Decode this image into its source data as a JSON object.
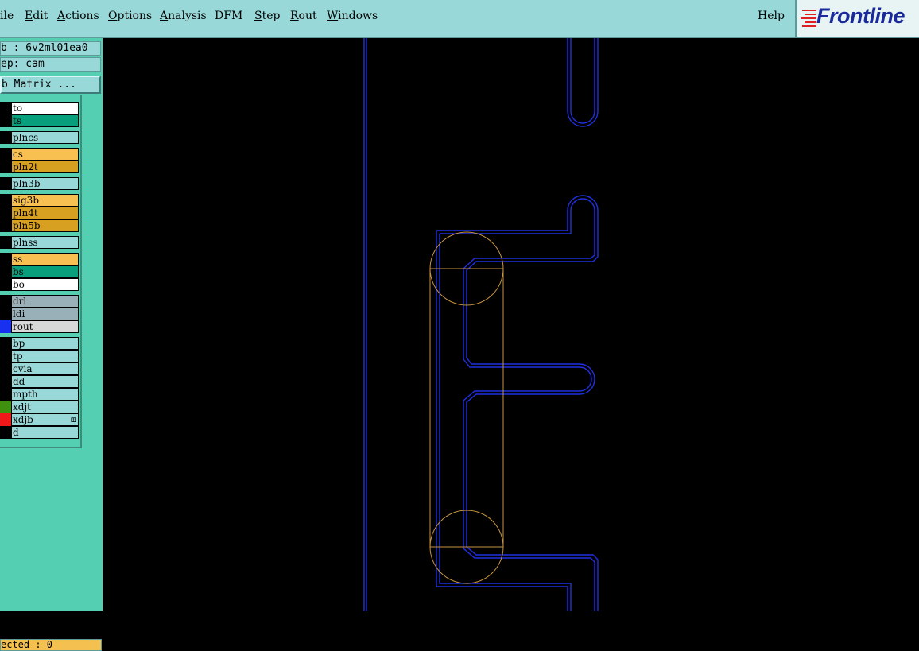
{
  "menu": {
    "items": [
      {
        "pre": "",
        "u": "",
        "post": "ile"
      },
      {
        "pre": "",
        "u": "E",
        "post": "dit"
      },
      {
        "pre": "",
        "u": "A",
        "post": "ctions"
      },
      {
        "pre": "",
        "u": "O",
        "post": "ptions"
      },
      {
        "pre": "",
        "u": "A",
        "post": "nalysis"
      },
      {
        "pre": "",
        "u": "",
        "post": "DFM"
      },
      {
        "pre": "",
        "u": "S",
        "post": "tep"
      },
      {
        "pre": "",
        "u": "R",
        "post": "out"
      },
      {
        "pre": "",
        "u": "W",
        "post": "indows"
      }
    ],
    "help": "Help"
  },
  "logo": {
    "text": "Frontline",
    "color": "#1a2a9a",
    "accent": "#e02020"
  },
  "sidebar": {
    "job": "b : 6v2ml01ea0",
    "step": "ep: cam",
    "matrix_button": "b Matrix ...",
    "selected": "ected : 0"
  },
  "layers": [
    {
      "name": "to",
      "bg": "#ffffff",
      "swatch": "#000000"
    },
    {
      "name": "ts",
      "bg": "#08a07c",
      "swatch": "#000000"
    },
    {
      "name": "plncs",
      "bg": "#99d8d8",
      "swatch": "#000000"
    },
    {
      "name": "cs",
      "bg": "#f8c050",
      "swatch": "#000000"
    },
    {
      "name": "pln2t",
      "bg": "#d8a020",
      "swatch": "#000000"
    },
    {
      "name": "pln3b",
      "bg": "#99d8d8",
      "swatch": "#000000"
    },
    {
      "name": "sig3b",
      "bg": "#f8c050",
      "swatch": "#000000"
    },
    {
      "name": "pln4t",
      "bg": "#d8a020",
      "swatch": "#000000"
    },
    {
      "name": "pln5b",
      "bg": "#d8a020",
      "swatch": "#000000"
    },
    {
      "name": "plnss",
      "bg": "#99d8d8",
      "swatch": "#000000"
    },
    {
      "name": "ss",
      "bg": "#f8c050",
      "swatch": "#000000"
    },
    {
      "name": "bs",
      "bg": "#08a07c",
      "swatch": "#000000"
    },
    {
      "name": "bo",
      "bg": "#ffffff",
      "swatch": "#000000"
    },
    {
      "name": "drl",
      "bg": "#9ab0b8",
      "swatch": "#000000"
    },
    {
      "name": "ldi",
      "bg": "#9ab0b8",
      "swatch": "#000000"
    },
    {
      "name": "rout",
      "bg": "#d8d8d8",
      "swatch": "#1830f0"
    },
    {
      "name": "bp",
      "bg": "#99d8d8",
      "swatch": "#000000"
    },
    {
      "name": "tp",
      "bg": "#99d8d8",
      "swatch": "#000000"
    },
    {
      "name": "cvia",
      "bg": "#99d8d8",
      "swatch": "#000000"
    },
    {
      "name": "dd",
      "bg": "#99d8d8",
      "swatch": "#000000"
    },
    {
      "name": "mpth",
      "bg": "#99d8d8",
      "swatch": "#000000"
    },
    {
      "name": "xdjt",
      "bg": "#99d8d8",
      "swatch": "#409010"
    },
    {
      "name": "xdjb",
      "bg": "#99d8d8",
      "swatch": "#f01818",
      "marker": "⊞"
    },
    {
      "name": "d",
      "bg": "#99d8d8",
      "swatch": "#000000"
    }
  ],
  "colors": {
    "rout_line": "#2030e0",
    "profile_line": "#c89440",
    "panel_bg": "#55cfb2",
    "menu_bg": "#99d8d8"
  }
}
